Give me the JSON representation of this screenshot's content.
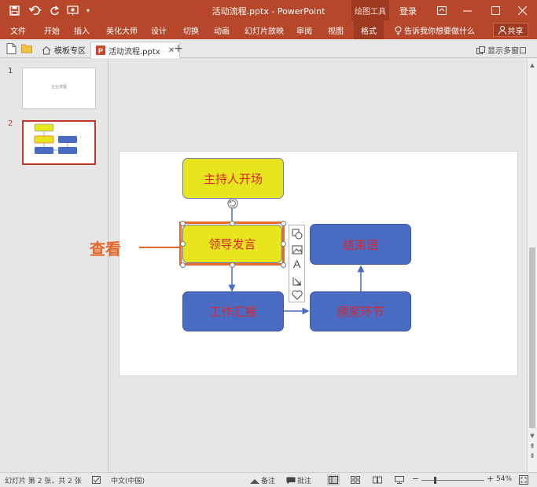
{
  "titlebar": {
    "title": "活动流程.pptx  -  PowerPoint",
    "context_tab": "绘图工具",
    "login": "登录"
  },
  "ribbon": {
    "tabs": [
      "文件",
      "开始",
      "插入",
      "美化大师",
      "设计",
      "切换",
      "动画",
      "幻灯片放映",
      "审阅",
      "视图",
      "格式"
    ],
    "active_tab": "格式",
    "tell_me": "告诉我你想要做什么",
    "share": "共享"
  },
  "doc_tabs": {
    "template_tab": "模板专区",
    "file_tab": "活动流程.pptx",
    "show_multi": "显示多窗口"
  },
  "thumbnails": [
    {
      "number": "1",
      "title": "企业流程"
    },
    {
      "number": "2",
      "selected": true
    }
  ],
  "slide": {
    "boxes": {
      "host": "主持人开场",
      "leader": "领导发言",
      "ending": "结束语",
      "report": "工作汇报",
      "award": "颁奖环节"
    },
    "annotation": "查看"
  },
  "statusbar": {
    "slide_info": "幻灯片 第 2 张，共 2 张",
    "language": "中文(中国)",
    "notes": "备注",
    "comments": "批注",
    "zoom_minus": "−",
    "zoom_plus": "+",
    "zoom": "54%"
  },
  "colors": {
    "accent": "#b7472a",
    "box_yellow": "#e6e51e",
    "box_blue": "#4a6bc2",
    "box_text": "#d9262f",
    "selection": "#e86a2c",
    "annotation": "#e8652a"
  }
}
